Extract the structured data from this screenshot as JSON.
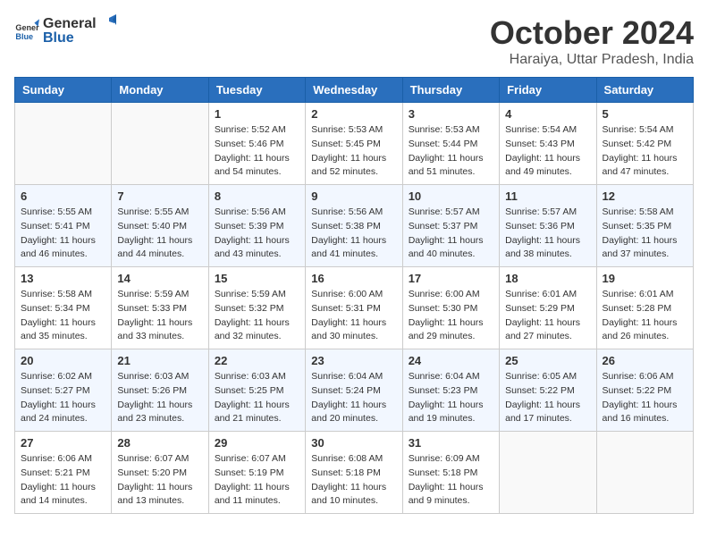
{
  "header": {
    "logo_general": "General",
    "logo_blue": "Blue",
    "month_title": "October 2024",
    "location": "Haraiya, Uttar Pradesh, India"
  },
  "weekdays": [
    "Sunday",
    "Monday",
    "Tuesday",
    "Wednesday",
    "Thursday",
    "Friday",
    "Saturday"
  ],
  "weeks": [
    [
      {
        "day": "",
        "info": ""
      },
      {
        "day": "",
        "info": ""
      },
      {
        "day": "1",
        "info": "Sunrise: 5:52 AM\nSunset: 5:46 PM\nDaylight: 11 hours and 54 minutes."
      },
      {
        "day": "2",
        "info": "Sunrise: 5:53 AM\nSunset: 5:45 PM\nDaylight: 11 hours and 52 minutes."
      },
      {
        "day": "3",
        "info": "Sunrise: 5:53 AM\nSunset: 5:44 PM\nDaylight: 11 hours and 51 minutes."
      },
      {
        "day": "4",
        "info": "Sunrise: 5:54 AM\nSunset: 5:43 PM\nDaylight: 11 hours and 49 minutes."
      },
      {
        "day": "5",
        "info": "Sunrise: 5:54 AM\nSunset: 5:42 PM\nDaylight: 11 hours and 47 minutes."
      }
    ],
    [
      {
        "day": "6",
        "info": "Sunrise: 5:55 AM\nSunset: 5:41 PM\nDaylight: 11 hours and 46 minutes."
      },
      {
        "day": "7",
        "info": "Sunrise: 5:55 AM\nSunset: 5:40 PM\nDaylight: 11 hours and 44 minutes."
      },
      {
        "day": "8",
        "info": "Sunrise: 5:56 AM\nSunset: 5:39 PM\nDaylight: 11 hours and 43 minutes."
      },
      {
        "day": "9",
        "info": "Sunrise: 5:56 AM\nSunset: 5:38 PM\nDaylight: 11 hours and 41 minutes."
      },
      {
        "day": "10",
        "info": "Sunrise: 5:57 AM\nSunset: 5:37 PM\nDaylight: 11 hours and 40 minutes."
      },
      {
        "day": "11",
        "info": "Sunrise: 5:57 AM\nSunset: 5:36 PM\nDaylight: 11 hours and 38 minutes."
      },
      {
        "day": "12",
        "info": "Sunrise: 5:58 AM\nSunset: 5:35 PM\nDaylight: 11 hours and 37 minutes."
      }
    ],
    [
      {
        "day": "13",
        "info": "Sunrise: 5:58 AM\nSunset: 5:34 PM\nDaylight: 11 hours and 35 minutes."
      },
      {
        "day": "14",
        "info": "Sunrise: 5:59 AM\nSunset: 5:33 PM\nDaylight: 11 hours and 33 minutes."
      },
      {
        "day": "15",
        "info": "Sunrise: 5:59 AM\nSunset: 5:32 PM\nDaylight: 11 hours and 32 minutes."
      },
      {
        "day": "16",
        "info": "Sunrise: 6:00 AM\nSunset: 5:31 PM\nDaylight: 11 hours and 30 minutes."
      },
      {
        "day": "17",
        "info": "Sunrise: 6:00 AM\nSunset: 5:30 PM\nDaylight: 11 hours and 29 minutes."
      },
      {
        "day": "18",
        "info": "Sunrise: 6:01 AM\nSunset: 5:29 PM\nDaylight: 11 hours and 27 minutes."
      },
      {
        "day": "19",
        "info": "Sunrise: 6:01 AM\nSunset: 5:28 PM\nDaylight: 11 hours and 26 minutes."
      }
    ],
    [
      {
        "day": "20",
        "info": "Sunrise: 6:02 AM\nSunset: 5:27 PM\nDaylight: 11 hours and 24 minutes."
      },
      {
        "day": "21",
        "info": "Sunrise: 6:03 AM\nSunset: 5:26 PM\nDaylight: 11 hours and 23 minutes."
      },
      {
        "day": "22",
        "info": "Sunrise: 6:03 AM\nSunset: 5:25 PM\nDaylight: 11 hours and 21 minutes."
      },
      {
        "day": "23",
        "info": "Sunrise: 6:04 AM\nSunset: 5:24 PM\nDaylight: 11 hours and 20 minutes."
      },
      {
        "day": "24",
        "info": "Sunrise: 6:04 AM\nSunset: 5:23 PM\nDaylight: 11 hours and 19 minutes."
      },
      {
        "day": "25",
        "info": "Sunrise: 6:05 AM\nSunset: 5:22 PM\nDaylight: 11 hours and 17 minutes."
      },
      {
        "day": "26",
        "info": "Sunrise: 6:06 AM\nSunset: 5:22 PM\nDaylight: 11 hours and 16 minutes."
      }
    ],
    [
      {
        "day": "27",
        "info": "Sunrise: 6:06 AM\nSunset: 5:21 PM\nDaylight: 11 hours and 14 minutes."
      },
      {
        "day": "28",
        "info": "Sunrise: 6:07 AM\nSunset: 5:20 PM\nDaylight: 11 hours and 13 minutes."
      },
      {
        "day": "29",
        "info": "Sunrise: 6:07 AM\nSunset: 5:19 PM\nDaylight: 11 hours and 11 minutes."
      },
      {
        "day": "30",
        "info": "Sunrise: 6:08 AM\nSunset: 5:18 PM\nDaylight: 11 hours and 10 minutes."
      },
      {
        "day": "31",
        "info": "Sunrise: 6:09 AM\nSunset: 5:18 PM\nDaylight: 11 hours and 9 minutes."
      },
      {
        "day": "",
        "info": ""
      },
      {
        "day": "",
        "info": ""
      }
    ]
  ]
}
